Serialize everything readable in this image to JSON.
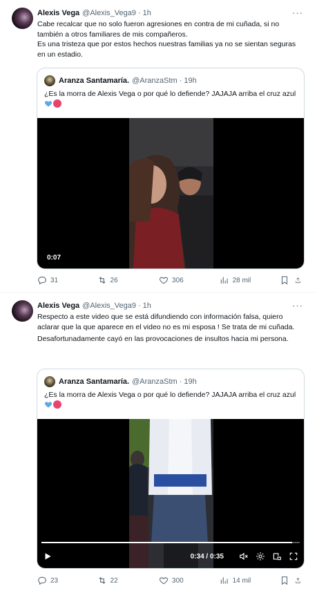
{
  "tweets": [
    {
      "author": {
        "name": "Alexis Vega",
        "handle": "@Alexis_Vega9",
        "time": "1h"
      },
      "text": [
        "Cabe recalcar que no solo fueron agresiones en contra de mi cuñada, si no también a otros familiares de mis compañeros.",
        "Es una tristeza que por estos hechos nuestras familias ya no se sientan seguras en un estadio."
      ],
      "quote": {
        "author": {
          "name": "Aranza Santamaría.",
          "handle": "@AranzaStm",
          "time": "19h"
        },
        "text": "¿Es la morra de Alexis Vega o por qué lo defiende? JAJAJA arriba el cruz azul",
        "video": {
          "counter": "0:07"
        }
      },
      "stats": {
        "replies": "31",
        "retweets": "26",
        "likes": "306",
        "views": "28 mil"
      }
    },
    {
      "author": {
        "name": "Alexis Vega",
        "handle": "@Alexis_Vega9",
        "time": "1h"
      },
      "text": [
        "Respecto a este video que se está difundiendo con información falsa, quiero aclarar que la que aparece en el video no es mi esposa ! Se trata de mi cuñada.",
        "Desafortunadamente cayó en las provocaciones de insultos hacia mi persona."
      ],
      "quote": {
        "author": {
          "name": "Aranza Santamaría.",
          "handle": "@AranzaStm",
          "time": "19h"
        },
        "text": "¿Es la morra de Alexis Vega o por qué lo defiende? JAJAJA arriba el cruz azul",
        "video": {
          "time": "0:34 / 0:35",
          "progress": 0.97
        }
      },
      "stats": {
        "replies": "23",
        "retweets": "22",
        "likes": "300",
        "views": "14 mil"
      }
    }
  ],
  "icons": {
    "more": "more-icon",
    "reply": "reply-icon",
    "retweet": "retweet-icon",
    "like": "heart-icon",
    "views": "views-icon",
    "bookmark": "bookmark-icon",
    "share": "share-icon",
    "play": "play-icon",
    "mute": "mute-icon",
    "settings": "gear-icon",
    "pip": "pip-icon",
    "fullscreen": "fullscreen-icon"
  },
  "colors": {
    "text": "#0f1419",
    "secondary": "#536471",
    "border": "#cfd9de",
    "heart": "#5fa7e8"
  }
}
